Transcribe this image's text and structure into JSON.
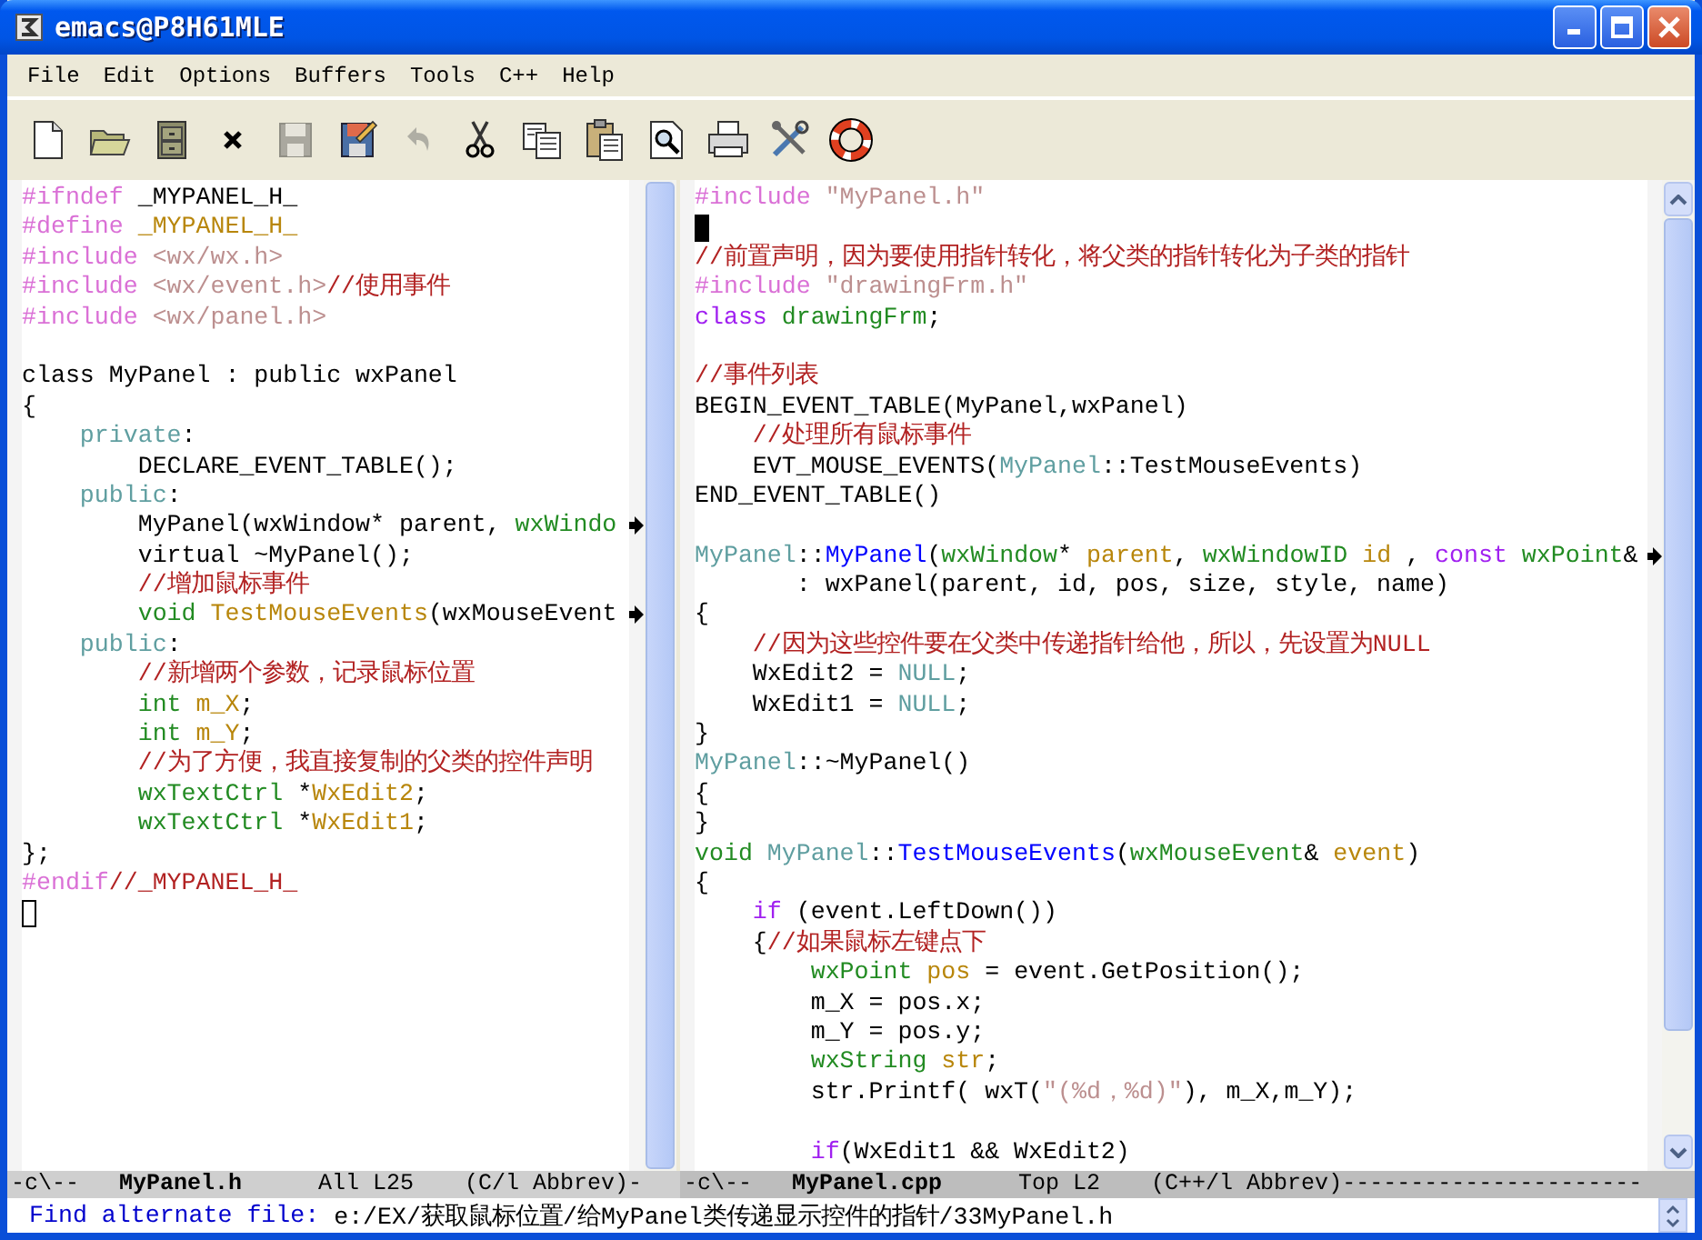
{
  "window": {
    "title": "emacs@P8H61MLE"
  },
  "menu": [
    "File",
    "Edit",
    "Options",
    "Buffers",
    "Tools",
    "C++",
    "Help"
  ],
  "toolbar": [
    {
      "kind": "new"
    },
    {
      "kind": "open"
    },
    {
      "kind": "cabinet"
    },
    {
      "kind": "close"
    },
    {
      "kind": "save",
      "disabled": true
    },
    {
      "kind": "saveas"
    },
    {
      "kind": "undo",
      "disabled": true
    },
    {
      "kind": "cut"
    },
    {
      "kind": "copy"
    },
    {
      "kind": "paste"
    },
    {
      "kind": "search"
    },
    {
      "kind": "print"
    },
    {
      "kind": "tools"
    },
    {
      "kind": "help"
    }
  ],
  "panes": [
    {
      "active": false,
      "lines": [
        {
          "kind": "code",
          "tokens": [
            {
              "kind": "preproc",
              "text": "#ifndef"
            },
            {
              "kind": "plain",
              "text": " _MYPANEL_H_"
            }
          ]
        },
        {
          "kind": "code",
          "tokens": [
            {
              "kind": "preproc",
              "text": "#define"
            },
            {
              "kind": "variable",
              "text": " _MYPANEL_H_"
            }
          ]
        },
        {
          "kind": "code",
          "tokens": [
            {
              "kind": "preproc",
              "text": "#include"
            },
            {
              "kind": "string",
              "text": " <wx/wx.h>"
            }
          ]
        },
        {
          "kind": "code",
          "tokens": [
            {
              "kind": "preproc",
              "text": "#include"
            },
            {
              "kind": "string",
              "text": " <wx/event.h>"
            },
            {
              "kind": "comment",
              "text": "//使用事件"
            }
          ]
        },
        {
          "kind": "code",
          "tokens": [
            {
              "kind": "preproc",
              "text": "#include"
            },
            {
              "kind": "string",
              "text": " <wx/panel.h>"
            }
          ]
        },
        {
          "kind": "blank"
        },
        {
          "kind": "code",
          "tokens": [
            {
              "kind": "plain",
              "text": "class MyPanel : public wxPanel"
            }
          ]
        },
        {
          "kind": "code",
          "tokens": [
            {
              "kind": "plain",
              "text": "{"
            }
          ]
        },
        {
          "kind": "code",
          "tokens": [
            {
              "kind": "constant",
              "text": "    private"
            },
            {
              "kind": "plain",
              "text": ":"
            }
          ]
        },
        {
          "kind": "code",
          "tokens": [
            {
              "kind": "plain",
              "text": "        DECLARE_EVENT_TABLE();"
            }
          ]
        },
        {
          "kind": "code",
          "tokens": [
            {
              "kind": "constant",
              "text": "    public"
            },
            {
              "kind": "plain",
              "text": ":"
            }
          ]
        },
        {
          "kind": "code",
          "truncated": true,
          "tokens": [
            {
              "kind": "plain",
              "text": "        MyPanel(wxWindow* parent,"
            },
            {
              "kind": "type",
              "text": " wxWindo"
            }
          ]
        },
        {
          "kind": "code",
          "tokens": [
            {
              "kind": "plain",
              "text": "        virtual ~MyPanel();"
            }
          ]
        },
        {
          "kind": "code",
          "tokens": [
            {
              "kind": "comment",
              "text": "        //增加鼠标事件"
            }
          ]
        },
        {
          "kind": "code",
          "truncated": true,
          "tokens": [
            {
              "kind": "type",
              "text": "        void"
            },
            {
              "kind": "variable",
              "text": " TestMouseEvents"
            },
            {
              "kind": "plain",
              "text": "(wxMouseEvent"
            }
          ]
        },
        {
          "kind": "code",
          "tokens": [
            {
              "kind": "constant",
              "text": "    public"
            },
            {
              "kind": "plain",
              "text": ":"
            }
          ]
        },
        {
          "kind": "code",
          "tokens": [
            {
              "kind": "comment",
              "text": "        //新增两个参数，记录鼠标位置"
            }
          ]
        },
        {
          "kind": "code",
          "tokens": [
            {
              "kind": "type",
              "text": "        int"
            },
            {
              "kind": "variable",
              "text": " m_X"
            },
            {
              "kind": "plain",
              "text": ";"
            }
          ]
        },
        {
          "kind": "code",
          "tokens": [
            {
              "kind": "type",
              "text": "        int"
            },
            {
              "kind": "variable",
              "text": " m_Y"
            },
            {
              "kind": "plain",
              "text": ";"
            }
          ]
        },
        {
          "kind": "code",
          "tokens": [
            {
              "kind": "comment",
              "text": "        //为了方便，我直接复制的父类的控件声明"
            }
          ]
        },
        {
          "kind": "code",
          "tokens": [
            {
              "kind": "type",
              "text": "        wxTextCtrl"
            },
            {
              "kind": "plain",
              "text": " *"
            },
            {
              "kind": "variable",
              "text": "WxEdit2"
            },
            {
              "kind": "plain",
              "text": ";"
            }
          ]
        },
        {
          "kind": "code",
          "tokens": [
            {
              "kind": "type",
              "text": "        wxTextCtrl"
            },
            {
              "kind": "plain",
              "text": " *"
            },
            {
              "kind": "variable",
              "text": "WxEdit1"
            },
            {
              "kind": "plain",
              "text": ";"
            }
          ]
        },
        {
          "kind": "code",
          "tokens": [
            {
              "kind": "plain",
              "text": "};"
            }
          ]
        },
        {
          "kind": "code",
          "tokens": [
            {
              "kind": "preproc",
              "text": "#endif"
            },
            {
              "kind": "comment",
              "text": "//_MYPANEL_H_"
            }
          ]
        },
        {
          "kind": "cursor"
        }
      ],
      "mode_line": {
        "prefix": "-c\\--",
        "buffer": "MyPanel.h",
        "position": "All L25",
        "mode": "(C/l Abbrev)-"
      }
    },
    {
      "active": true,
      "lines": [
        {
          "kind": "code",
          "tokens": [
            {
              "kind": "preproc",
              "text": "#include"
            },
            {
              "kind": "string",
              "text": " \"MyPanel.h\""
            }
          ]
        },
        {
          "kind": "cursor"
        },
        {
          "kind": "code",
          "tokens": [
            {
              "kind": "comment",
              "text": "//前置声明，因为要使用指针转化，将父类的指针转化为子类的指针"
            }
          ]
        },
        {
          "kind": "code",
          "tokens": [
            {
              "kind": "preproc",
              "text": "#include"
            },
            {
              "kind": "string",
              "text": " \"drawingFrm.h\""
            }
          ]
        },
        {
          "kind": "code",
          "tokens": [
            {
              "kind": "keyword",
              "text": "class"
            },
            {
              "kind": "type",
              "text": " drawingFrm"
            },
            {
              "kind": "plain",
              "text": ";"
            }
          ]
        },
        {
          "kind": "blank"
        },
        {
          "kind": "code",
          "tokens": [
            {
              "kind": "comment",
              "text": "//事件列表"
            }
          ]
        },
        {
          "kind": "code",
          "tokens": [
            {
              "kind": "plain",
              "text": "BEGIN_EVENT_TABLE(MyPanel,wxPanel)"
            }
          ]
        },
        {
          "kind": "code",
          "tokens": [
            {
              "kind": "comment",
              "text": "    //处理所有鼠标事件"
            }
          ]
        },
        {
          "kind": "code",
          "tokens": [
            {
              "kind": "plain",
              "text": "    EVT_MOUSE_EVENTS("
            },
            {
              "kind": "constant",
              "text": "MyPanel"
            },
            {
              "kind": "plain",
              "text": "::TestMouseEvents)"
            }
          ]
        },
        {
          "kind": "code",
          "tokens": [
            {
              "kind": "plain",
              "text": "END_EVENT_TABLE()"
            }
          ]
        },
        {
          "kind": "blank"
        },
        {
          "kind": "code",
          "truncated": true,
          "tokens": [
            {
              "kind": "constant",
              "text": "MyPanel"
            },
            {
              "kind": "plain",
              "text": "::"
            },
            {
              "kind": "function",
              "text": "MyPanel"
            },
            {
              "kind": "plain",
              "text": "("
            },
            {
              "kind": "type",
              "text": "wxWindow"
            },
            {
              "kind": "plain",
              "text": "*"
            },
            {
              "kind": "variable",
              "text": " parent"
            },
            {
              "kind": "plain",
              "text": ","
            },
            {
              "kind": "type",
              "text": " wxWindowID"
            },
            {
              "kind": "variable",
              "text": " id"
            },
            {
              "kind": "plain",
              "text": " ,"
            },
            {
              "kind": "keyword",
              "text": " const"
            },
            {
              "kind": "type",
              "text": " wxPoint"
            },
            {
              "kind": "plain",
              "text": "&"
            }
          ]
        },
        {
          "kind": "code",
          "tokens": [
            {
              "kind": "plain",
              "text": "       : wxPanel(parent, id, pos, size, style, name)"
            }
          ]
        },
        {
          "kind": "code",
          "tokens": [
            {
              "kind": "plain",
              "text": "{"
            }
          ]
        },
        {
          "kind": "code",
          "tokens": [
            {
              "kind": "comment",
              "text": "    //因为这些控件要在父类中传递指针给他，所以，先设置为NULL"
            }
          ]
        },
        {
          "kind": "code",
          "tokens": [
            {
              "kind": "plain",
              "text": "    WxEdit2 = "
            },
            {
              "kind": "constant",
              "text": "NULL"
            },
            {
              "kind": "plain",
              "text": ";"
            }
          ]
        },
        {
          "kind": "code",
          "tokens": [
            {
              "kind": "plain",
              "text": "    WxEdit1 = "
            },
            {
              "kind": "constant",
              "text": "NULL"
            },
            {
              "kind": "plain",
              "text": ";"
            }
          ]
        },
        {
          "kind": "code",
          "tokens": [
            {
              "kind": "plain",
              "text": "}"
            }
          ]
        },
        {
          "kind": "code",
          "tokens": [
            {
              "kind": "constant",
              "text": "MyPanel"
            },
            {
              "kind": "plain",
              "text": "::~MyPanel()"
            }
          ]
        },
        {
          "kind": "code",
          "tokens": [
            {
              "kind": "plain",
              "text": "{"
            }
          ]
        },
        {
          "kind": "code",
          "tokens": [
            {
              "kind": "plain",
              "text": "}"
            }
          ]
        },
        {
          "kind": "code",
          "tokens": [
            {
              "kind": "type",
              "text": "void"
            },
            {
              "kind": "constant",
              "text": " MyPanel"
            },
            {
              "kind": "plain",
              "text": "::"
            },
            {
              "kind": "function",
              "text": "TestMouseEvents"
            },
            {
              "kind": "plain",
              "text": "("
            },
            {
              "kind": "type",
              "text": "wxMouseEvent"
            },
            {
              "kind": "plain",
              "text": "&"
            },
            {
              "kind": "variable",
              "text": " event"
            },
            {
              "kind": "plain",
              "text": ")"
            }
          ]
        },
        {
          "kind": "code",
          "tokens": [
            {
              "kind": "plain",
              "text": "{"
            }
          ]
        },
        {
          "kind": "code",
          "tokens": [
            {
              "kind": "keyword",
              "text": "    if"
            },
            {
              "kind": "plain",
              "text": " (event.LeftDown())"
            }
          ]
        },
        {
          "kind": "code",
          "tokens": [
            {
              "kind": "plain",
              "text": "    {"
            },
            {
              "kind": "comment",
              "text": "//如果鼠标左键点下"
            }
          ]
        },
        {
          "kind": "code",
          "tokens": [
            {
              "kind": "type",
              "text": "        wxPoint"
            },
            {
              "kind": "variable",
              "text": " pos"
            },
            {
              "kind": "plain",
              "text": " = event.GetPosition();"
            }
          ]
        },
        {
          "kind": "code",
          "tokens": [
            {
              "kind": "plain",
              "text": "        m_X = pos.x;"
            }
          ]
        },
        {
          "kind": "code",
          "tokens": [
            {
              "kind": "plain",
              "text": "        m_Y = pos.y;"
            }
          ]
        },
        {
          "kind": "code",
          "tokens": [
            {
              "kind": "type",
              "text": "        wxString"
            },
            {
              "kind": "variable",
              "text": " str"
            },
            {
              "kind": "plain",
              "text": ";"
            }
          ]
        },
        {
          "kind": "code",
          "tokens": [
            {
              "kind": "plain",
              "text": "        str.Printf( wxT("
            },
            {
              "kind": "string",
              "text": "\"(%d，%d)\""
            },
            {
              "kind": "plain",
              "text": "), m_X,m_Y);"
            }
          ]
        },
        {
          "kind": "blank"
        },
        {
          "kind": "code",
          "tokens": [
            {
              "kind": "keyword",
              "text": "        if"
            },
            {
              "kind": "plain",
              "text": "(WxEdit1 && WxEdit2)"
            }
          ]
        }
      ],
      "mode_line": {
        "prefix": "-c\\--",
        "buffer": "MyPanel.cpp",
        "position": "Top L2",
        "mode": "(C++/l Abbrev)",
        "fill": "----------------------"
      }
    }
  ],
  "minibuffer": {
    "prompt": "Find alternate file:",
    "value": "e:/EX/获取鼠标位置/给MyPanel类传递显示控件的指针/33MyPanel.h"
  }
}
